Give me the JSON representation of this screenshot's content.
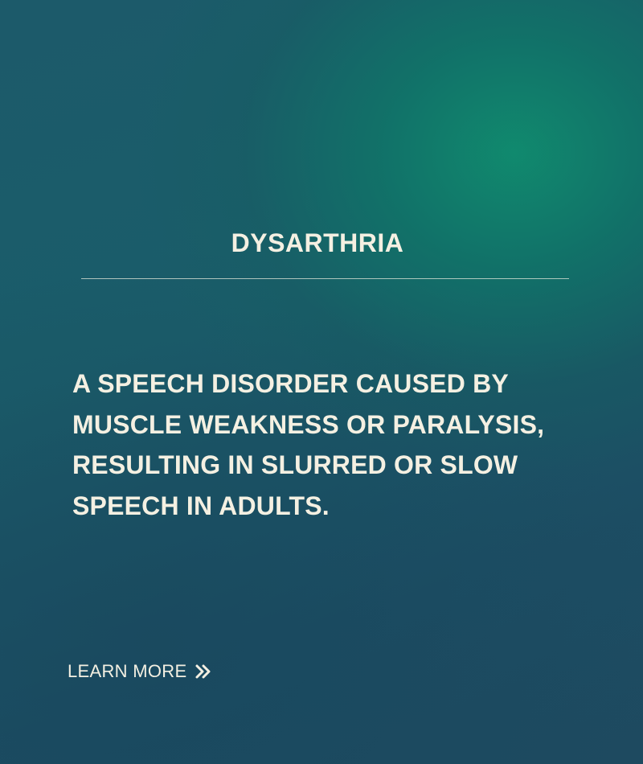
{
  "card": {
    "title": "DYSARTHRIA",
    "description": "A SPEECH DISORDER CAUSED BY MUSCLE WEAKNESS OR PARALYSIS, RESULTING IN SLURRED OR SLOW SPEECH IN ADULTS.",
    "cta_label": "LEARN MORE",
    "cta_icon": "double-chevron-right-icon"
  },
  "colors": {
    "text": "#f4f0e2",
    "background_dark": "#1c4d63",
    "background_glow": "#108c6e"
  }
}
